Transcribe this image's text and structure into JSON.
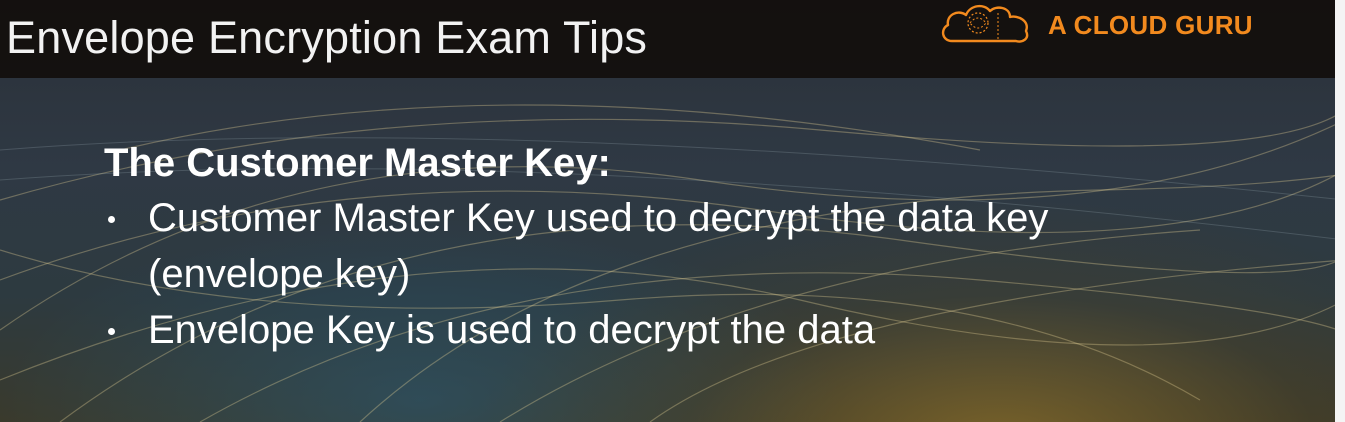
{
  "slide": {
    "title": "Envelope Encryption Exam Tips"
  },
  "logo": {
    "icon": "cloud-icon",
    "text": "A CLOUD GURU",
    "color": "#f28a1e"
  },
  "content": {
    "heading": "The Customer Master Key:",
    "bullets": [
      "Customer Master Key used to decrypt the data key (envelope key)",
      "Envelope Key is used to decrypt the data"
    ]
  }
}
